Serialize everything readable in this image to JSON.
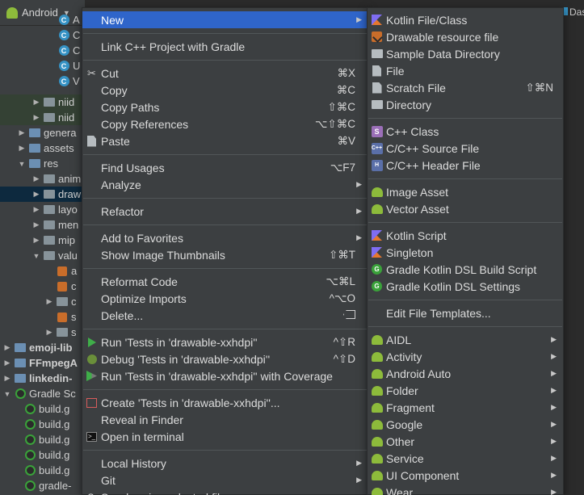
{
  "tree": {
    "header": "Android",
    "rows": [
      {
        "label": "A",
        "icon": "class-icon"
      },
      {
        "label": "C",
        "icon": "class-icon"
      },
      {
        "label": "C",
        "icon": "class-icon"
      },
      {
        "label": "U",
        "icon": "class-icon"
      },
      {
        "label": "V",
        "icon": "class-icon"
      },
      {
        "label": "niid",
        "icon": "folder-icon"
      },
      {
        "label": "niid",
        "icon": "folder-icon"
      },
      {
        "label": "genera",
        "icon": "folder-icon"
      },
      {
        "label": "assets",
        "icon": "folder-icon"
      },
      {
        "label": "res",
        "icon": "folder-icon"
      },
      {
        "label": "anim",
        "icon": "folder-icon"
      },
      {
        "label": "draw",
        "icon": "folder-icon"
      },
      {
        "label": "layo",
        "icon": "folder-icon"
      },
      {
        "label": "men",
        "icon": "folder-icon"
      },
      {
        "label": "mip",
        "icon": "folder-icon"
      },
      {
        "label": "valu",
        "icon": "folder-icon"
      },
      {
        "label": "a",
        "icon": "xml-icon"
      },
      {
        "label": "c",
        "icon": "xml-icon"
      },
      {
        "label": "c",
        "icon": "folder-icon"
      },
      {
        "label": "s",
        "icon": "xml-icon"
      },
      {
        "label": "s",
        "icon": "folder-icon"
      },
      {
        "label": "emoji-lib",
        "icon": "folder-icon"
      },
      {
        "label": "FFmpegA",
        "icon": "folder-icon"
      },
      {
        "label": "linkedin-",
        "icon": "folder-icon"
      },
      {
        "label": "Gradle Sc",
        "icon": "gradle-icon"
      },
      {
        "label": "build.g",
        "icon": "gradle-icon"
      },
      {
        "label": "build.g",
        "icon": "gradle-icon"
      },
      {
        "label": "build.g",
        "icon": "gradle-icon"
      },
      {
        "label": "build.g",
        "icon": "gradle-icon"
      },
      {
        "label": "build.g",
        "icon": "gradle-icon"
      },
      {
        "label": "gradle-",
        "icon": "gradle-icon"
      }
    ]
  },
  "editor": {
    "tab_label": "Das"
  },
  "main_menu": {
    "items": [
      {
        "label": "New",
        "shortcut": "",
        "submenu": true,
        "icon": ""
      },
      {
        "label": "Link C++ Project with Gradle",
        "shortcut": "",
        "submenu": false,
        "icon": ""
      },
      {
        "label": "Cut",
        "shortcut": "⌘X",
        "submenu": false,
        "icon": "scissors-icon"
      },
      {
        "label": "Copy",
        "shortcut": "⌘C",
        "submenu": false,
        "icon": ""
      },
      {
        "label": "Copy Paths",
        "shortcut": "⇧⌘C",
        "submenu": false,
        "icon": ""
      },
      {
        "label": "Copy References",
        "shortcut": "⌥⇧⌘C",
        "submenu": false,
        "icon": ""
      },
      {
        "label": "Paste",
        "shortcut": "⌘V",
        "submenu": false,
        "icon": "paste-icon"
      },
      {
        "label": "Find Usages",
        "shortcut": "⌥F7",
        "submenu": false,
        "icon": ""
      },
      {
        "label": "Analyze",
        "shortcut": "",
        "submenu": true,
        "icon": ""
      },
      {
        "label": "Refactor",
        "shortcut": "",
        "submenu": true,
        "icon": ""
      },
      {
        "label": "Add to Favorites",
        "shortcut": "",
        "submenu": true,
        "icon": ""
      },
      {
        "label": "Show Image Thumbnails",
        "shortcut": "⇧⌘T",
        "submenu": false,
        "icon": ""
      },
      {
        "label": "Reformat Code",
        "shortcut": "⌥⌘L",
        "submenu": false,
        "icon": ""
      },
      {
        "label": "Optimize Imports",
        "shortcut": "^⌥O",
        "submenu": false,
        "icon": ""
      },
      {
        "label": "Delete...",
        "shortcut": "⌦",
        "submenu": false,
        "icon": ""
      },
      {
        "label": "Run 'Tests in 'drawable-xxhdpi''",
        "shortcut": "^⇧R",
        "submenu": false,
        "icon": "run-icon"
      },
      {
        "label": "Debug 'Tests in 'drawable-xxhdpi''",
        "shortcut": "^⇧D",
        "submenu": false,
        "icon": "debug-icon"
      },
      {
        "label": "Run 'Tests in 'drawable-xxhdpi'' with Coverage",
        "shortcut": "",
        "submenu": false,
        "icon": "coverage-icon"
      },
      {
        "label": "Create 'Tests in 'drawable-xxhdpi''...",
        "shortcut": "",
        "submenu": false,
        "icon": "create-test-icon"
      },
      {
        "label": "Reveal in Finder",
        "shortcut": "",
        "submenu": false,
        "icon": ""
      },
      {
        "label": "Open in terminal",
        "shortcut": "",
        "submenu": false,
        "icon": "terminal-icon"
      },
      {
        "label": "Local History",
        "shortcut": "",
        "submenu": true,
        "icon": ""
      },
      {
        "label": "Git",
        "shortcut": "",
        "submenu": true,
        "icon": ""
      },
      {
        "label": "Synchronize selected files",
        "shortcut": "",
        "submenu": false,
        "icon": "sync-icon"
      }
    ]
  },
  "sub_menu": {
    "items": [
      {
        "label": "Kotlin File/Class",
        "shortcut": "",
        "submenu": false,
        "icon": "kotlin-icon"
      },
      {
        "label": "Drawable resource file",
        "shortcut": "",
        "submenu": false,
        "icon": "drawable-icon"
      },
      {
        "label": "Sample Data Directory",
        "shortcut": "",
        "submenu": false,
        "icon": "folder-icon"
      },
      {
        "label": "File",
        "shortcut": "",
        "submenu": false,
        "icon": "file-icon"
      },
      {
        "label": "Scratch File",
        "shortcut": "⇧⌘N",
        "submenu": false,
        "icon": "scratch-file-icon"
      },
      {
        "label": "Directory",
        "shortcut": "",
        "submenu": false,
        "icon": "folder-icon"
      },
      {
        "label": "C++ Class",
        "shortcut": "",
        "submenu": false,
        "icon": "cpp-class-icon"
      },
      {
        "label": "C/C++ Source File",
        "shortcut": "",
        "submenu": false,
        "icon": "cpp-source-icon"
      },
      {
        "label": "C/C++ Header File",
        "shortcut": "",
        "submenu": false,
        "icon": "cpp-header-icon"
      },
      {
        "label": "Image Asset",
        "shortcut": "",
        "submenu": false,
        "icon": "android-icon"
      },
      {
        "label": "Vector Asset",
        "shortcut": "",
        "submenu": false,
        "icon": "android-icon"
      },
      {
        "label": "Kotlin Script",
        "shortcut": "",
        "submenu": false,
        "icon": "kotlin-script-icon"
      },
      {
        "label": "Singleton",
        "shortcut": "",
        "submenu": false,
        "icon": "kotlin-icon"
      },
      {
        "label": "Gradle Kotlin DSL Build Script",
        "shortcut": "",
        "submenu": false,
        "icon": "gradle-icon"
      },
      {
        "label": "Gradle Kotlin DSL Settings",
        "shortcut": "",
        "submenu": false,
        "icon": "gradle-icon"
      },
      {
        "label": "Edit File Templates...",
        "shortcut": "",
        "submenu": false,
        "icon": ""
      },
      {
        "label": "AIDL",
        "shortcut": "",
        "submenu": true,
        "icon": "android-icon"
      },
      {
        "label": "Activity",
        "shortcut": "",
        "submenu": true,
        "icon": "android-icon"
      },
      {
        "label": "Android Auto",
        "shortcut": "",
        "submenu": true,
        "icon": "android-icon"
      },
      {
        "label": "Folder",
        "shortcut": "",
        "submenu": true,
        "icon": "android-icon"
      },
      {
        "label": "Fragment",
        "shortcut": "",
        "submenu": true,
        "icon": "android-icon"
      },
      {
        "label": "Google",
        "shortcut": "",
        "submenu": true,
        "icon": "android-icon"
      },
      {
        "label": "Other",
        "shortcut": "",
        "submenu": true,
        "icon": "android-icon"
      },
      {
        "label": "Service",
        "shortcut": "",
        "submenu": true,
        "icon": "android-icon"
      },
      {
        "label": "UI Component",
        "shortcut": "",
        "submenu": true,
        "icon": "android-icon"
      },
      {
        "label": "Wear",
        "shortcut": "",
        "submenu": true,
        "icon": "android-icon"
      }
    ]
  },
  "colors": {
    "menu_bg": "#3c3f41",
    "highlight": "#2f65ca",
    "tree_selected": "#0d293e",
    "android_green": "#8dbb3b"
  }
}
